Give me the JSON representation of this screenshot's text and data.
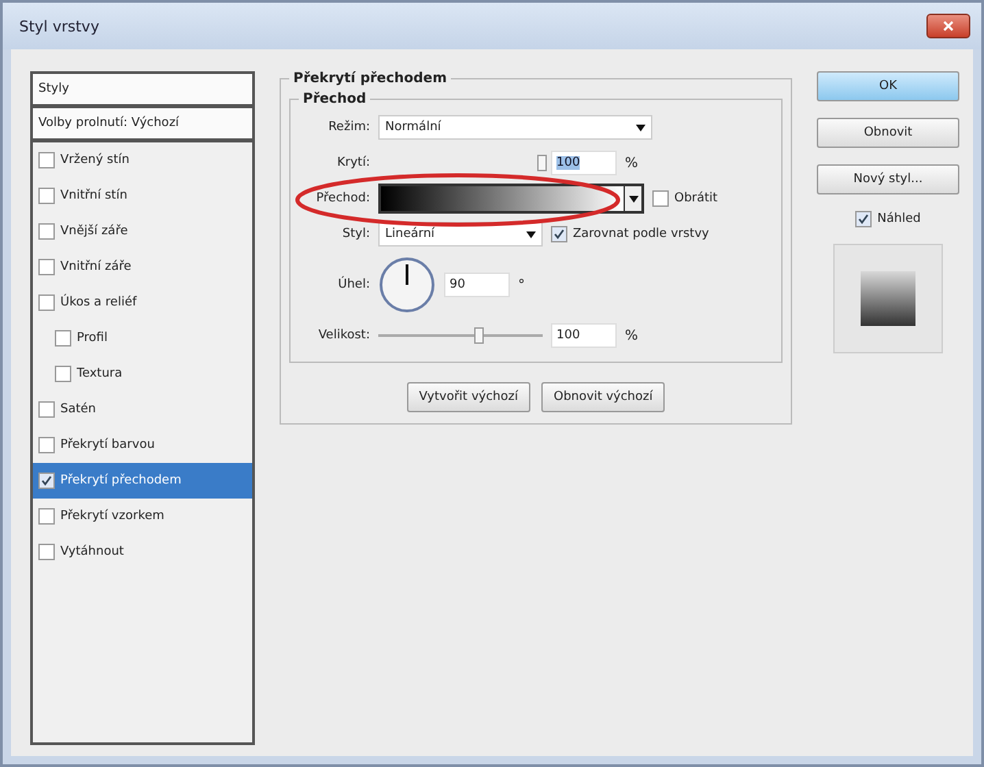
{
  "window": {
    "title": "Styl vrstvy"
  },
  "sidebar": {
    "items": [
      {
        "label": "Styly",
        "kind": "header",
        "selected": false
      },
      {
        "label": "Volby prolnutí: Výchozí",
        "kind": "header",
        "selected": false
      },
      {
        "label": "Vržený stín",
        "kind": "check",
        "checked": false,
        "selected": false
      },
      {
        "label": "Vnitřní stín",
        "kind": "check",
        "checked": false,
        "selected": false
      },
      {
        "label": "Vnější záře",
        "kind": "check",
        "checked": false,
        "selected": false
      },
      {
        "label": "Vnitřní záře",
        "kind": "check",
        "checked": false,
        "selected": false
      },
      {
        "label": "Úkos a reliéf",
        "kind": "check",
        "checked": false,
        "selected": false,
        "children": [
          {
            "label": "Profil",
            "kind": "check",
            "checked": false,
            "selected": false
          },
          {
            "label": "Textura",
            "kind": "check",
            "checked": false,
            "selected": false
          }
        ]
      },
      {
        "label": "Satén",
        "kind": "check",
        "checked": false,
        "selected": false
      },
      {
        "label": "Překrytí barvou",
        "kind": "check",
        "checked": false,
        "selected": false
      },
      {
        "label": "Překrytí přechodem",
        "kind": "check",
        "checked": true,
        "selected": true
      },
      {
        "label": "Překrytí vzorkem",
        "kind": "check",
        "checked": false,
        "selected": false
      },
      {
        "label": "Vytáhnout",
        "kind": "check",
        "checked": false,
        "selected": false
      }
    ]
  },
  "panel": {
    "title": "Překrytí přechodem",
    "group_title": "Přechod",
    "mode": {
      "label": "Režim:",
      "value": "Normální"
    },
    "opacity": {
      "label": "Krytí:",
      "value": "100",
      "unit": "%",
      "level": 1
    },
    "gradient": {
      "label": "Přechod:",
      "reverse_label": "Obrátit",
      "reverse_checked": false
    },
    "style": {
      "label": "Styl:",
      "value": "Lineární",
      "align_label": "Zarovnat podle vrstvy",
      "align_checked": true
    },
    "angle": {
      "label": "Úhel:",
      "value": "90",
      "unit": "°"
    },
    "scale": {
      "label": "Velikost:",
      "value": "100",
      "unit": "%",
      "level": 0.62
    },
    "buttons": [
      "Vytvořit výchozí",
      "Obnovit výchozí"
    ]
  },
  "actions": {
    "buttons": [
      {
        "label": "OK",
        "primary": true
      },
      {
        "label": "Obnovit",
        "primary": false
      },
      {
        "label": "Nový styl...",
        "primary": false
      }
    ],
    "preview_label": "Náhled",
    "preview_checked": true
  }
}
